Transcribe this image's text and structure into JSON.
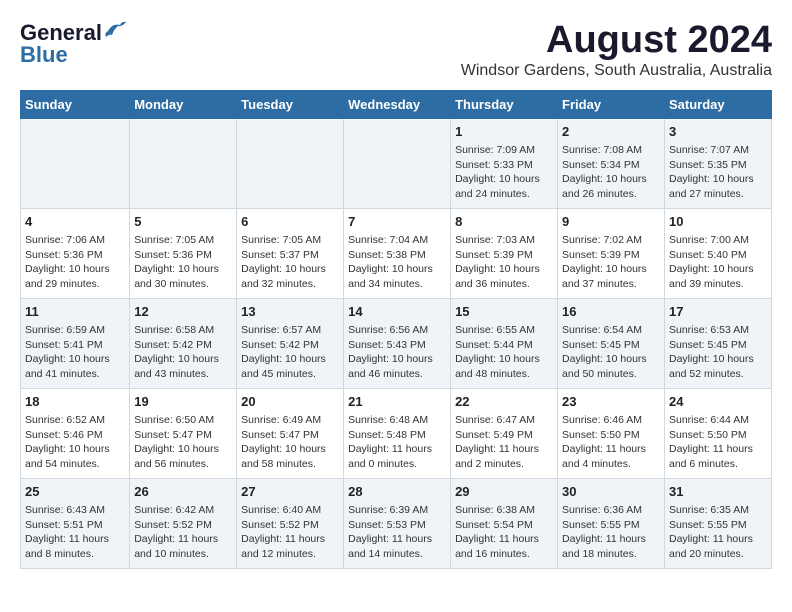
{
  "logo": {
    "general": "General",
    "blue": "Blue"
  },
  "title": "August 2024",
  "subtitle": "Windsor Gardens, South Australia, Australia",
  "days_of_week": [
    "Sunday",
    "Monday",
    "Tuesday",
    "Wednesday",
    "Thursday",
    "Friday",
    "Saturday"
  ],
  "weeks": [
    [
      {
        "day": "",
        "info": ""
      },
      {
        "day": "",
        "info": ""
      },
      {
        "day": "",
        "info": ""
      },
      {
        "day": "",
        "info": ""
      },
      {
        "day": "1",
        "info": "Sunrise: 7:09 AM\nSunset: 5:33 PM\nDaylight: 10 hours\nand 24 minutes."
      },
      {
        "day": "2",
        "info": "Sunrise: 7:08 AM\nSunset: 5:34 PM\nDaylight: 10 hours\nand 26 minutes."
      },
      {
        "day": "3",
        "info": "Sunrise: 7:07 AM\nSunset: 5:35 PM\nDaylight: 10 hours\nand 27 minutes."
      }
    ],
    [
      {
        "day": "4",
        "info": "Sunrise: 7:06 AM\nSunset: 5:36 PM\nDaylight: 10 hours\nand 29 minutes."
      },
      {
        "day": "5",
        "info": "Sunrise: 7:05 AM\nSunset: 5:36 PM\nDaylight: 10 hours\nand 30 minutes."
      },
      {
        "day": "6",
        "info": "Sunrise: 7:05 AM\nSunset: 5:37 PM\nDaylight: 10 hours\nand 32 minutes."
      },
      {
        "day": "7",
        "info": "Sunrise: 7:04 AM\nSunset: 5:38 PM\nDaylight: 10 hours\nand 34 minutes."
      },
      {
        "day": "8",
        "info": "Sunrise: 7:03 AM\nSunset: 5:39 PM\nDaylight: 10 hours\nand 36 minutes."
      },
      {
        "day": "9",
        "info": "Sunrise: 7:02 AM\nSunset: 5:39 PM\nDaylight: 10 hours\nand 37 minutes."
      },
      {
        "day": "10",
        "info": "Sunrise: 7:00 AM\nSunset: 5:40 PM\nDaylight: 10 hours\nand 39 minutes."
      }
    ],
    [
      {
        "day": "11",
        "info": "Sunrise: 6:59 AM\nSunset: 5:41 PM\nDaylight: 10 hours\nand 41 minutes."
      },
      {
        "day": "12",
        "info": "Sunrise: 6:58 AM\nSunset: 5:42 PM\nDaylight: 10 hours\nand 43 minutes."
      },
      {
        "day": "13",
        "info": "Sunrise: 6:57 AM\nSunset: 5:42 PM\nDaylight: 10 hours\nand 45 minutes."
      },
      {
        "day": "14",
        "info": "Sunrise: 6:56 AM\nSunset: 5:43 PM\nDaylight: 10 hours\nand 46 minutes."
      },
      {
        "day": "15",
        "info": "Sunrise: 6:55 AM\nSunset: 5:44 PM\nDaylight: 10 hours\nand 48 minutes."
      },
      {
        "day": "16",
        "info": "Sunrise: 6:54 AM\nSunset: 5:45 PM\nDaylight: 10 hours\nand 50 minutes."
      },
      {
        "day": "17",
        "info": "Sunrise: 6:53 AM\nSunset: 5:45 PM\nDaylight: 10 hours\nand 52 minutes."
      }
    ],
    [
      {
        "day": "18",
        "info": "Sunrise: 6:52 AM\nSunset: 5:46 PM\nDaylight: 10 hours\nand 54 minutes."
      },
      {
        "day": "19",
        "info": "Sunrise: 6:50 AM\nSunset: 5:47 PM\nDaylight: 10 hours\nand 56 minutes."
      },
      {
        "day": "20",
        "info": "Sunrise: 6:49 AM\nSunset: 5:47 PM\nDaylight: 10 hours\nand 58 minutes."
      },
      {
        "day": "21",
        "info": "Sunrise: 6:48 AM\nSunset: 5:48 PM\nDaylight: 11 hours\nand 0 minutes."
      },
      {
        "day": "22",
        "info": "Sunrise: 6:47 AM\nSunset: 5:49 PM\nDaylight: 11 hours\nand 2 minutes."
      },
      {
        "day": "23",
        "info": "Sunrise: 6:46 AM\nSunset: 5:50 PM\nDaylight: 11 hours\nand 4 minutes."
      },
      {
        "day": "24",
        "info": "Sunrise: 6:44 AM\nSunset: 5:50 PM\nDaylight: 11 hours\nand 6 minutes."
      }
    ],
    [
      {
        "day": "25",
        "info": "Sunrise: 6:43 AM\nSunset: 5:51 PM\nDaylight: 11 hours\nand 8 minutes."
      },
      {
        "day": "26",
        "info": "Sunrise: 6:42 AM\nSunset: 5:52 PM\nDaylight: 11 hours\nand 10 minutes."
      },
      {
        "day": "27",
        "info": "Sunrise: 6:40 AM\nSunset: 5:52 PM\nDaylight: 11 hours\nand 12 minutes."
      },
      {
        "day": "28",
        "info": "Sunrise: 6:39 AM\nSunset: 5:53 PM\nDaylight: 11 hours\nand 14 minutes."
      },
      {
        "day": "29",
        "info": "Sunrise: 6:38 AM\nSunset: 5:54 PM\nDaylight: 11 hours\nand 16 minutes."
      },
      {
        "day": "30",
        "info": "Sunrise: 6:36 AM\nSunset: 5:55 PM\nDaylight: 11 hours\nand 18 minutes."
      },
      {
        "day": "31",
        "info": "Sunrise: 6:35 AM\nSunset: 5:55 PM\nDaylight: 11 hours\nand 20 minutes."
      }
    ]
  ]
}
